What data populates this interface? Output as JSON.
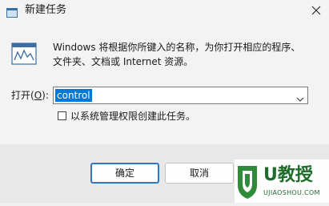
{
  "window": {
    "title": "新建任务",
    "icon": "run-icon"
  },
  "description": {
    "line1": "Windows 将根据你所键入的名称，为你打开相应的程序、",
    "line2": "文件夹、文档或 Internet 资源。"
  },
  "open": {
    "label_prefix": "打开(",
    "label_mnemonic": "O",
    "label_suffix": "):",
    "value": "control"
  },
  "admin_checkbox": {
    "label": "以系统管理权限创建此任务。",
    "checked": false
  },
  "buttons": {
    "ok": "确定",
    "cancel": "取消"
  },
  "watermark": {
    "brand": "U教授",
    "url": "UJIAOSHOU.COM"
  },
  "colors": {
    "selection": "#0078d7",
    "default_button_border": "#2f76c2",
    "watermark_green": "#2e8b3a"
  }
}
